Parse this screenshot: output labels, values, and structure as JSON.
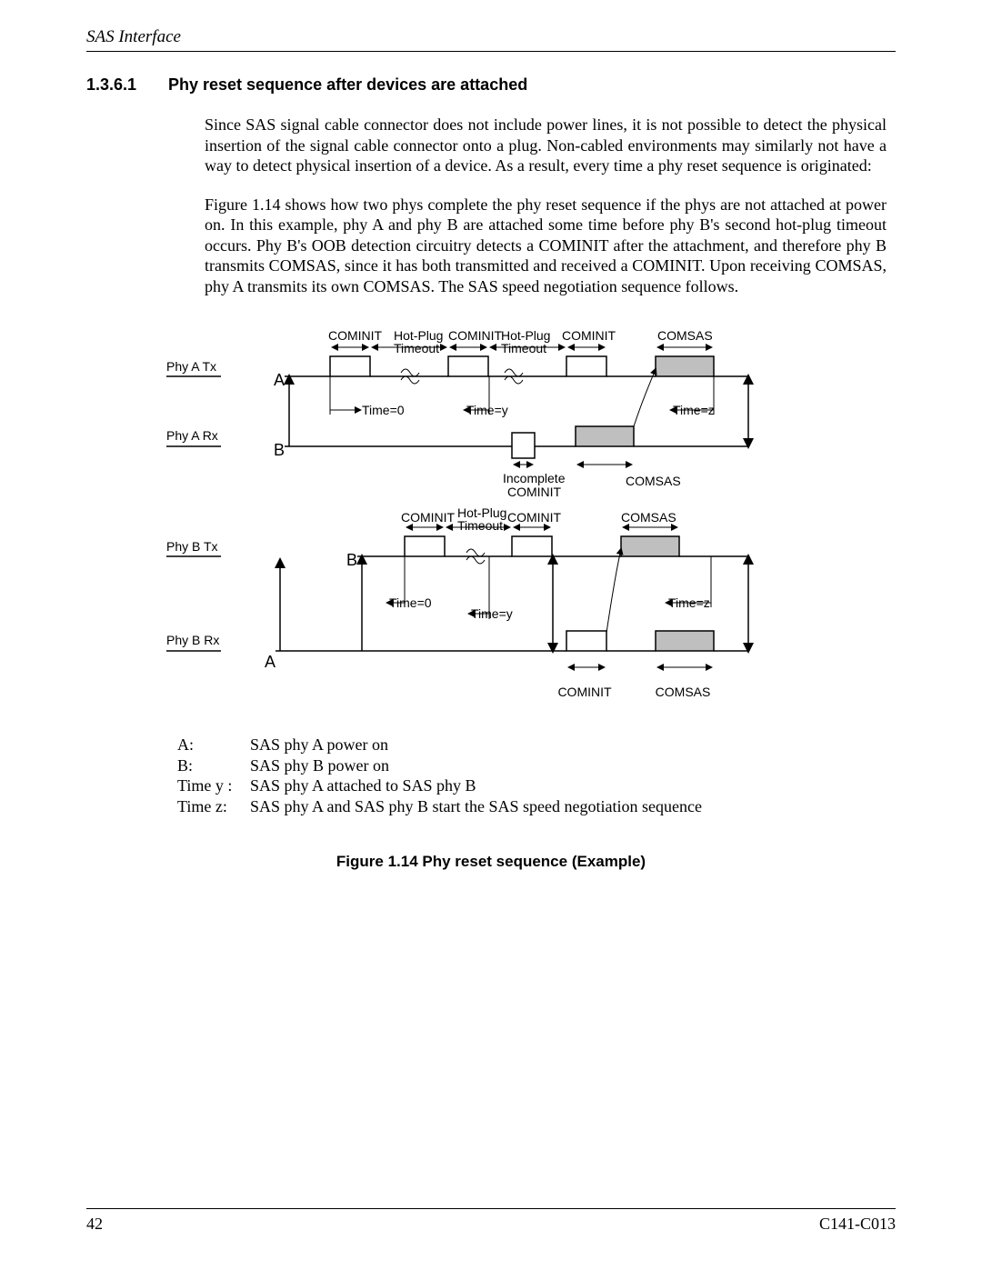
{
  "header": {
    "running": "SAS Interface"
  },
  "section": {
    "number": "1.3.6.1",
    "title": "Phy reset sequence after devices are attached",
    "para1": "Since SAS signal cable connector does not include power lines, it is not possible to detect the physical insertion of the signal cable connector onto a plug. Non-cabled environments may similarly not have a way to detect physical insertion of a device.  As a result, every time a phy reset sequence is originated:",
    "para2": "Figure 1.14 shows how two phys complete the phy reset sequence if the phys are not attached at power on.  In this example, phy A and phy B are attached some time before phy B's second hot-plug timeout occurs.  Phy B's OOB detection circuitry detects a COMINIT after the attachment, and therefore phy B transmits COMSAS, since it has both transmitted and received a COMINIT.  Upon receiving COMSAS, phy A transmits its own COMSAS. The SAS speed negotiation sequence follows."
  },
  "diagram": {
    "rows": {
      "phy_a_tx": "Phy A Tx",
      "phy_a_rx": "Phy A Rx",
      "phy_b_tx": "Phy B Tx",
      "phy_b_rx": "Phy B Rx"
    },
    "letters": {
      "A": "A",
      "B": "B"
    },
    "labels": {
      "cominit": "COMINIT",
      "comsas": "COMSAS",
      "hotplug1": "Hot-Plug",
      "hotplug2": "Timeout",
      "time0": "Time=0",
      "timey": "Time=y",
      "timez": "Time=z",
      "incomplete1": "Incomplete",
      "incomplete2": "COMINIT"
    }
  },
  "legend": [
    {
      "key": "A:",
      "text": "SAS phy A power on"
    },
    {
      "key": "B:",
      "text": "SAS phy B power on"
    },
    {
      "key": "Time y :",
      "text": "SAS phy A attached to SAS phy B"
    },
    {
      "key": "Time z:",
      "text": "SAS phy A and SAS phy B start the SAS speed negotiation sequence"
    }
  ],
  "figure": {
    "caption": "Figure 1.14  Phy reset sequence (Example)"
  },
  "footer": {
    "page": "42",
    "docnum": "C141-C013"
  }
}
